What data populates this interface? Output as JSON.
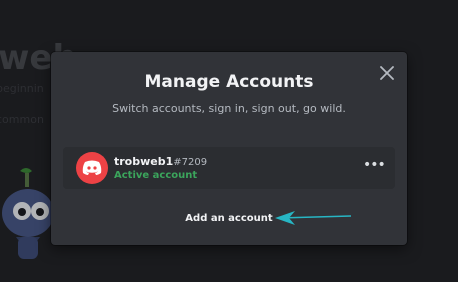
{
  "background": {
    "title_fragment": "web",
    "line1_fragment": "beginnin",
    "line2_fragment": "common"
  },
  "modal": {
    "title": "Manage Accounts",
    "subtitle": "Switch accounts, sign in, sign out, go wild.",
    "close_icon": "close-icon",
    "account": {
      "username": "trobweb1",
      "discriminator": "#7209",
      "status": "Active account",
      "avatar_icon": "discord-logo-icon",
      "more_icon": "more-horizontal-icon"
    },
    "add_account_label": "Add an account"
  },
  "colors": {
    "modal_bg": "#313338",
    "account_bg": "#2b2d31",
    "avatar_bg": "#ed4245",
    "active_green": "#3ba55c",
    "annotation_arrow": "#27b6c4"
  }
}
